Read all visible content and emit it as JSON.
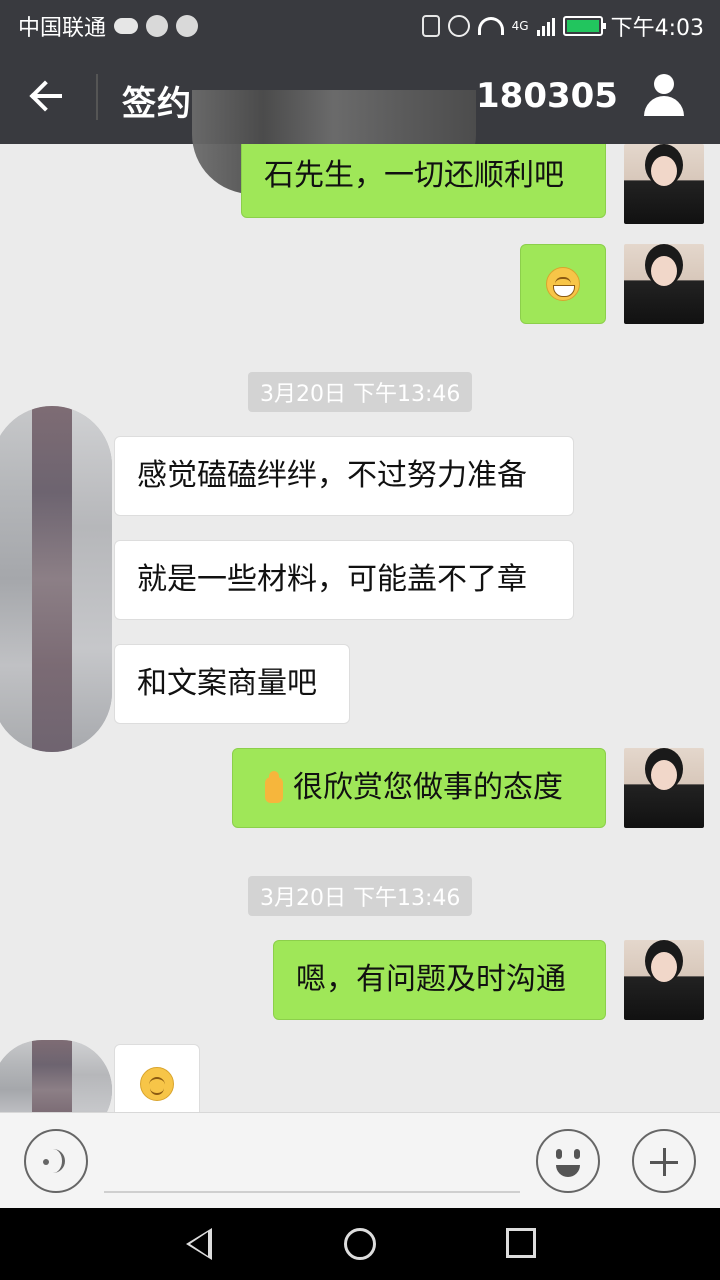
{
  "status_bar": {
    "carrier": "中国联通",
    "network": "4G",
    "time": "下午4:03"
  },
  "header": {
    "title_visible_prefix": "签约",
    "title_visible_suffix": "180305"
  },
  "chat": {
    "messages": [
      {
        "side": "right",
        "type": "text",
        "text": "石先生，一切还顺利吧"
      },
      {
        "side": "right",
        "type": "emoji",
        "emoji": "grinning-face"
      },
      {
        "type": "timestamp",
        "text": "3月20日 下午13:46"
      },
      {
        "side": "left",
        "type": "text",
        "text": "感觉磕磕绊绊，不过努力准备"
      },
      {
        "side": "left",
        "type": "text",
        "text": "就是一些材料，可能盖不了章"
      },
      {
        "side": "left",
        "type": "text",
        "text": "和文案商量吧"
      },
      {
        "side": "right",
        "type": "text",
        "text": "很欣赏您做事的态度",
        "prefix_emoji": "thumbs-up"
      },
      {
        "type": "timestamp",
        "text": "3月20日 下午13:46"
      },
      {
        "side": "right",
        "type": "text",
        "text": "嗯，有问题及时沟通"
      },
      {
        "side": "left",
        "type": "emoji",
        "emoji": "smiling-face"
      }
    ]
  },
  "colors": {
    "header_bg": "#393a3f",
    "chat_bg": "#ebebeb",
    "right_bubble": "#9fe758",
    "left_bubble": "#ffffff"
  }
}
